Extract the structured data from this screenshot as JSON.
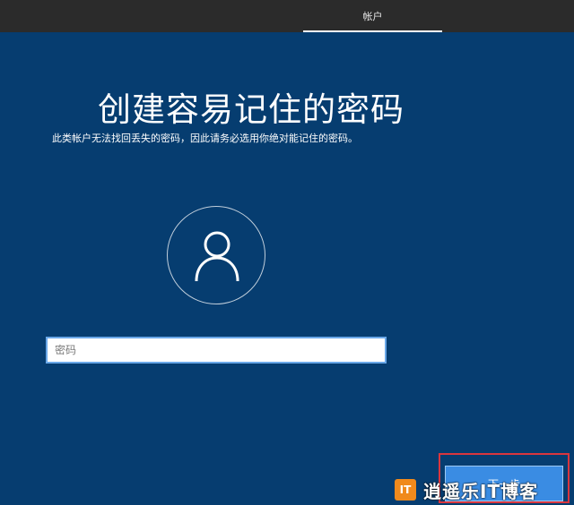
{
  "topbar": {
    "tab_label": "帐户"
  },
  "main": {
    "title": "创建容易记住的密码",
    "subtitle": "此类帐户无法找回丢失的密码，因此请务必选用你绝对能记住的密码。"
  },
  "password": {
    "placeholder": "密码",
    "value": ""
  },
  "next_button": {
    "label": "下一步"
  },
  "watermark": {
    "logo": "IT",
    "text": "逍遥乐IT博客"
  },
  "colors": {
    "background": "#063d70",
    "topbar": "#2b2b2b",
    "button": "#3a8ce3",
    "highlight": "#d9363e"
  },
  "icons": {
    "avatar": "user-icon"
  }
}
